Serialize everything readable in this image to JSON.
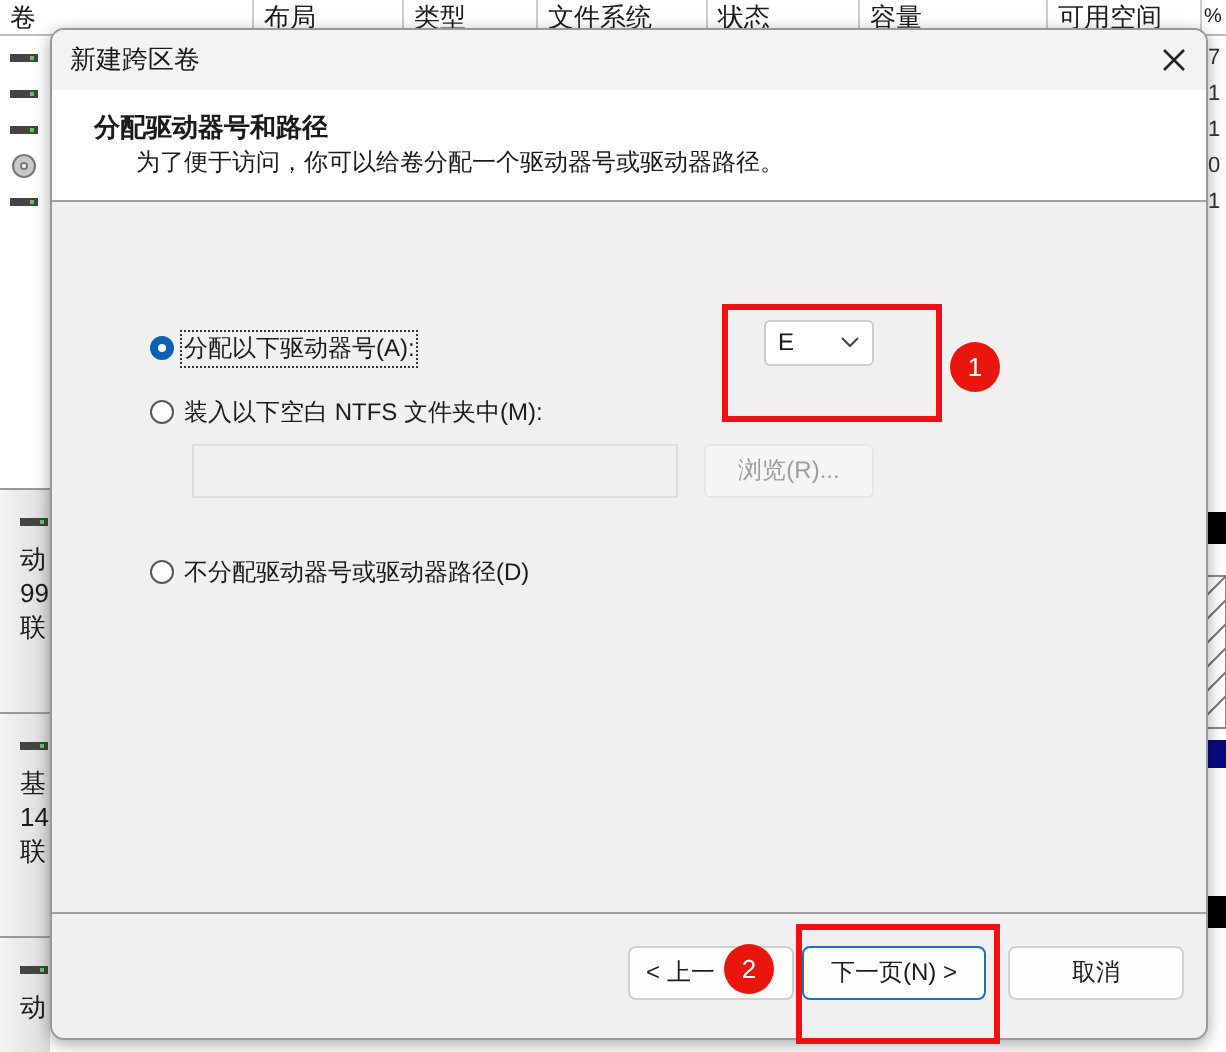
{
  "background": {
    "columns": [
      "卷",
      "布局",
      "类型",
      "文件系统",
      "状态",
      "容量",
      "可用空间",
      "%"
    ],
    "volume_rows": [
      {
        "kind": "disk",
        "column_8": "7"
      },
      {
        "kind": "disk",
        "column_8": "1"
      },
      {
        "kind": "disk",
        "column_8": "1"
      },
      {
        "kind": "cd",
        "column_8": "0"
      },
      {
        "kind": "disk",
        "column_8": "1"
      }
    ],
    "disks": [
      {
        "lines": [
          "动",
          "99",
          "联"
        ]
      },
      {
        "lines": [
          "基",
          "14",
          "联"
        ]
      },
      {
        "lines": [
          "动"
        ]
      }
    ]
  },
  "dialog": {
    "title": "新建跨区卷",
    "heading": "分配驱动器号和路径",
    "description": "为了便于访问，你可以给卷分配一个驱动器号或驱动器路径。",
    "options": [
      {
        "kind": "letter",
        "label": "分配以下驱动器号(A):",
        "selected": true
      },
      {
        "kind": "folder",
        "label": "装入以下空白 NTFS 文件夹中(M):",
        "selected": false
      },
      {
        "kind": "none",
        "label": "不分配驱动器号或驱动器路径(D)",
        "selected": false
      }
    ],
    "drive_letter": "E",
    "browse_button": {
      "label": "浏览(R)...",
      "disabled": true
    },
    "buttons": [
      {
        "kind": "back",
        "label": "< 上一",
        "default": false
      },
      {
        "kind": "next",
        "label": "下一页(N) >",
        "default": true
      },
      {
        "kind": "cancel",
        "label": "取消",
        "default": false
      }
    ]
  },
  "annotations": [
    {
      "number": "1"
    },
    {
      "number": "2"
    }
  ]
}
